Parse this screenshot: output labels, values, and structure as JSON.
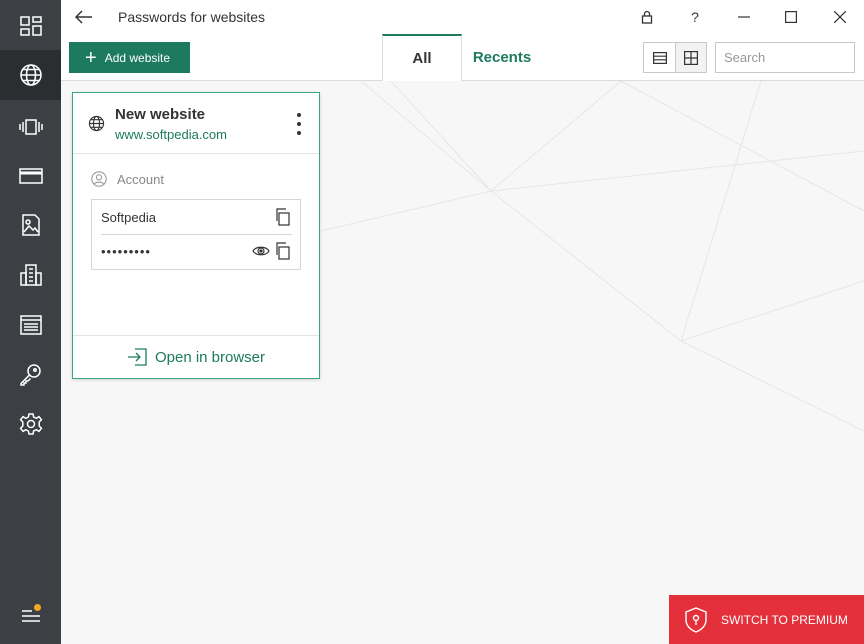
{
  "window": {
    "title": "Passwords for websites",
    "controls": [
      "lock-icon",
      "help-icon",
      "minimize-icon",
      "maximize-icon",
      "close-icon"
    ],
    "help_label": "?"
  },
  "sidebar": {
    "items": [
      {
        "icon": "dashboard-icon",
        "active": false
      },
      {
        "icon": "globe-icon",
        "active": true
      },
      {
        "icon": "apps-icon",
        "active": false
      },
      {
        "icon": "bank-card-icon",
        "active": false
      },
      {
        "icon": "image-document-icon",
        "active": false
      },
      {
        "icon": "building-icon",
        "active": false
      },
      {
        "icon": "notes-icon",
        "active": false
      },
      {
        "icon": "key-icon",
        "active": false
      },
      {
        "icon": "settings-icon",
        "active": false
      }
    ],
    "bottom_icon": "menu-icon"
  },
  "toolbar": {
    "add_label": "Add website",
    "tabs": [
      {
        "label": "All",
        "active": true
      },
      {
        "label": "Recents",
        "active": false
      }
    ],
    "view_modes": [
      "list-view-icon",
      "grid-view-icon"
    ],
    "search_placeholder": "Search"
  },
  "card": {
    "title": "New website",
    "url": "www.softpedia.com",
    "account_label": "Account",
    "username": "Softpedia",
    "password_masked": "•••••••••",
    "open_label": "Open in browser"
  },
  "premium": {
    "label": "SWITCH TO PREMIUM"
  },
  "colors": {
    "sidebar_bg": "#3c4044",
    "accent_green": "#1d7a5f",
    "premium_red": "#e3303a"
  }
}
